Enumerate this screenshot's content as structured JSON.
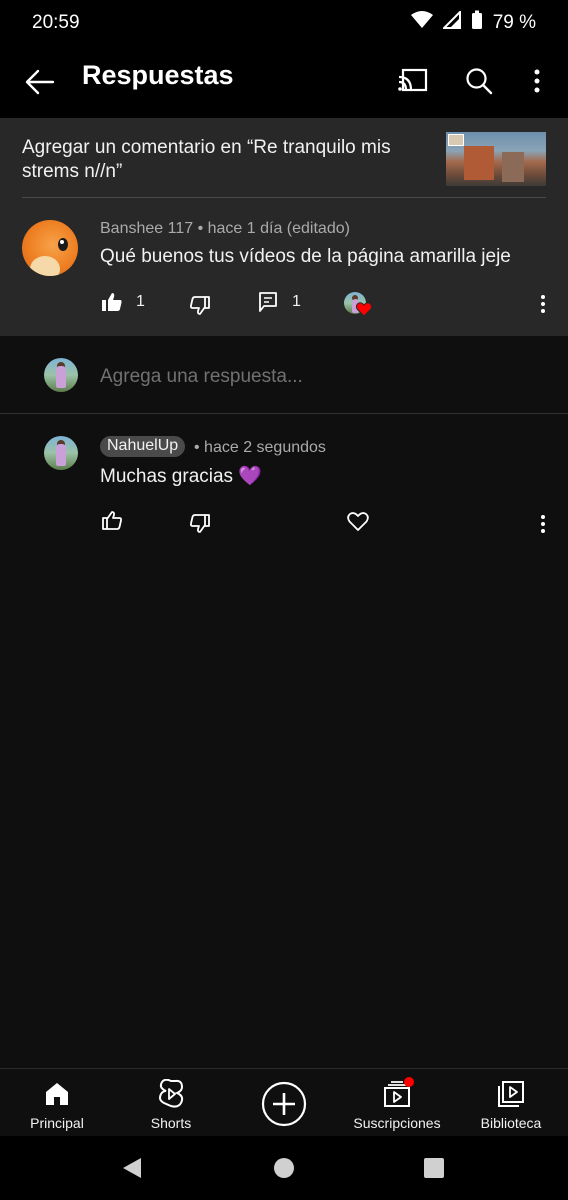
{
  "status_bar": {
    "time": "20:59",
    "battery": "79 %"
  },
  "app_bar": {
    "title": "Respuestas"
  },
  "comment_header": {
    "text": "Agregar un comentario en “Re tranquilo mis strems n//n”"
  },
  "main_comment": {
    "author": "Banshee 117",
    "time": "hace 1 día (editado)",
    "text": "Qué buenos tus vídeos de la página amarilla jeje",
    "like_count": "1",
    "reply_count": "1"
  },
  "reply_input": {
    "placeholder": "Agrega una respuesta..."
  },
  "reply": {
    "author": "NahuelUp",
    "time": "hace 2 segundos",
    "text": "Muchas gracias 💜"
  },
  "bottom_nav": {
    "items": [
      {
        "label": "Principal",
        "icon": "home-icon"
      },
      {
        "label": "Shorts",
        "icon": "shorts-icon"
      },
      {
        "label": "",
        "icon": "create-icon"
      },
      {
        "label": "Suscripciones",
        "icon": "subscriptions-icon"
      },
      {
        "label": "Biblioteca",
        "icon": "library-icon"
      }
    ]
  },
  "colors": {
    "background": "#0f0f0f",
    "panel": "#282828",
    "text": "#f1f1f1",
    "secondary_text": "#aaaaaa",
    "accent_red": "#ff0000"
  }
}
